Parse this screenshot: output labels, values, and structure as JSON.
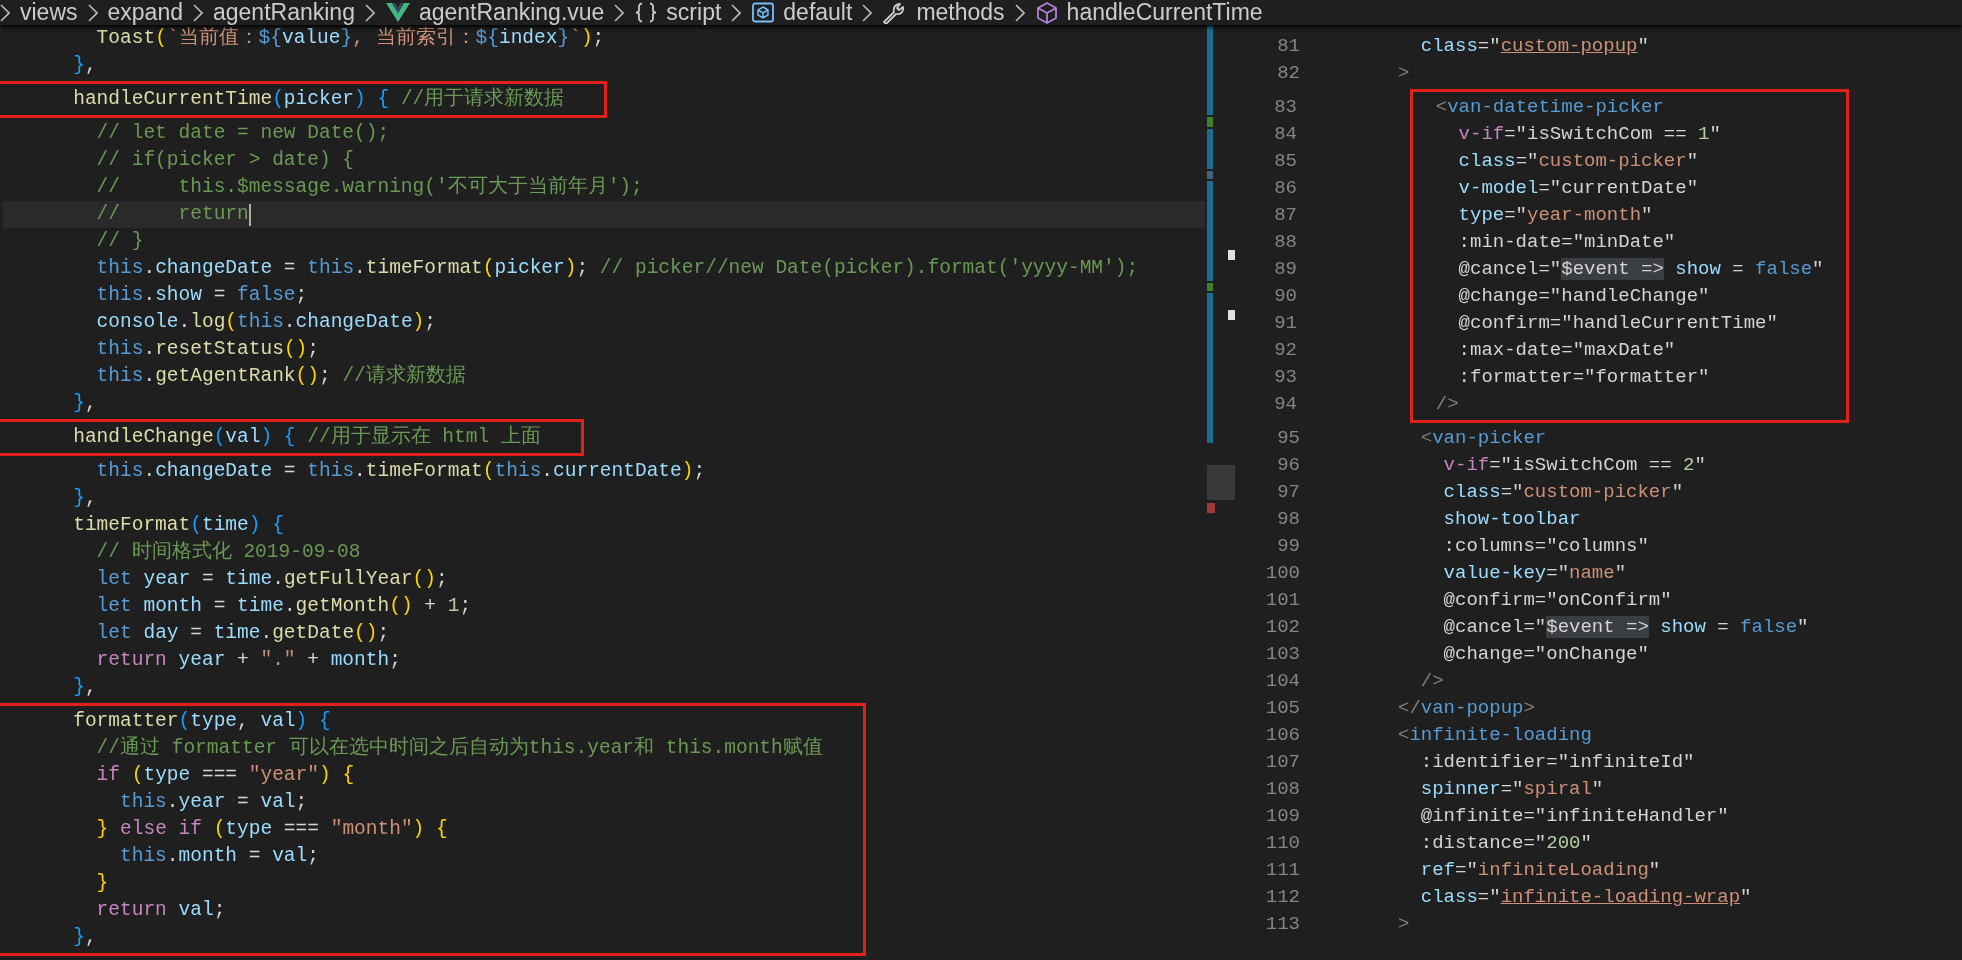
{
  "breadcrumb": [
    {
      "label": "views",
      "kind": "folder"
    },
    {
      "label": "expand",
      "kind": "folder"
    },
    {
      "label": "agentRanking",
      "kind": "folder"
    },
    {
      "label": "agentRanking.vue",
      "kind": "vue"
    },
    {
      "label": "script",
      "kind": "braces"
    },
    {
      "label": "default",
      "kind": "module"
    },
    {
      "label": "methods",
      "kind": "wrench"
    },
    {
      "label": "handleCurrentTime",
      "kind": "cube"
    }
  ],
  "left_editor": {
    "blocks": [
      {
        "boxed": false,
        "lines": [
          {
            "current": false,
            "tokens": [
              {
                "kind": "function",
                "text": "        Toast"
              },
              {
                "kind": "bracket1",
                "text": "("
              },
              {
                "kind": "string",
                "text": "`当前值："
              },
              {
                "kind": "keyword",
                "text": "${"
              },
              {
                "kind": "variable",
                "text": "value"
              },
              {
                "kind": "keyword",
                "text": "}"
              },
              {
                "kind": "string",
                "text": ", 当前索引："
              },
              {
                "kind": "keyword",
                "text": "${"
              },
              {
                "kind": "variable",
                "text": "index"
              },
              {
                "kind": "keyword",
                "text": "}"
              },
              {
                "kind": "string",
                "text": "`"
              },
              {
                "kind": "bracket1",
                "text": ")"
              },
              {
                "kind": "plain",
                "text": ";"
              }
            ]
          },
          {
            "current": false,
            "tokens": [
              {
                "kind": "bracket3",
                "text": "      }"
              },
              {
                "kind": "plain",
                "text": ","
              }
            ]
          }
        ]
      },
      {
        "boxed": true,
        "lines": [
          {
            "current": false,
            "tokens": [
              {
                "kind": "function",
                "text": "      handleCurrentTime"
              },
              {
                "kind": "bracket3",
                "text": "("
              },
              {
                "kind": "variable",
                "text": "picker"
              },
              {
                "kind": "bracket3",
                "text": ") {"
              },
              {
                "kind": "comment",
                "text": " //用于请求新数据"
              }
            ]
          }
        ]
      },
      {
        "boxed": false,
        "lines": [
          {
            "current": false,
            "tokens": [
              {
                "kind": "comment",
                "text": "        // let date = new Date();"
              }
            ]
          },
          {
            "current": false,
            "tokens": [
              {
                "kind": "comment",
                "text": "        // if(picker > date) {"
              }
            ]
          },
          {
            "current": false,
            "tokens": [
              {
                "kind": "comment",
                "text": "        //     this.$message.warning('不可大于当前年月');"
              }
            ]
          },
          {
            "current": true,
            "tokens": [
              {
                "kind": "comment",
                "text": "        //     return"
              }
            ]
          },
          {
            "current": false,
            "tokens": [
              {
                "kind": "comment",
                "text": "        // }"
              }
            ]
          },
          {
            "current": false,
            "tokens": [
              {
                "kind": "keyword",
                "text": "        this"
              },
              {
                "kind": "plain",
                "text": "."
              },
              {
                "kind": "variable",
                "text": "changeDate"
              },
              {
                "kind": "plain",
                "text": " = "
              },
              {
                "kind": "keyword",
                "text": "this"
              },
              {
                "kind": "plain",
                "text": "."
              },
              {
                "kind": "function",
                "text": "timeFormat"
              },
              {
                "kind": "bracket1",
                "text": "("
              },
              {
                "kind": "variable",
                "text": "picker"
              },
              {
                "kind": "bracket1",
                "text": ")"
              },
              {
                "kind": "plain",
                "text": ";"
              },
              {
                "kind": "comment",
                "text": " // picker//new Date(picker).format('yyyy-MM');"
              }
            ]
          },
          {
            "current": false,
            "tokens": [
              {
                "kind": "keyword",
                "text": "        this"
              },
              {
                "kind": "plain",
                "text": "."
              },
              {
                "kind": "variable",
                "text": "show"
              },
              {
                "kind": "plain",
                "text": " = "
              },
              {
                "kind": "keyword",
                "text": "false"
              },
              {
                "kind": "plain",
                "text": ";"
              }
            ]
          },
          {
            "current": false,
            "tokens": [
              {
                "kind": "variable",
                "text": "        console"
              },
              {
                "kind": "plain",
                "text": "."
              },
              {
                "kind": "function",
                "text": "log"
              },
              {
                "kind": "bracket1",
                "text": "("
              },
              {
                "kind": "keyword",
                "text": "this"
              },
              {
                "kind": "plain",
                "text": "."
              },
              {
                "kind": "variable",
                "text": "changeDate"
              },
              {
                "kind": "bracket1",
                "text": ")"
              },
              {
                "kind": "plain",
                "text": ";"
              }
            ]
          },
          {
            "current": false,
            "tokens": [
              {
                "kind": "keyword",
                "text": "        this"
              },
              {
                "kind": "plain",
                "text": "."
              },
              {
                "kind": "function",
                "text": "resetStatus"
              },
              {
                "kind": "bracket1",
                "text": "()"
              },
              {
                "kind": "plain",
                "text": ";"
              }
            ]
          },
          {
            "current": false,
            "tokens": [
              {
                "kind": "keyword",
                "text": "        this"
              },
              {
                "kind": "plain",
                "text": "."
              },
              {
                "kind": "function",
                "text": "getAgentRank"
              },
              {
                "kind": "bracket1",
                "text": "()"
              },
              {
                "kind": "plain",
                "text": ";"
              },
              {
                "kind": "comment",
                "text": " //请求新数据"
              }
            ]
          },
          {
            "current": false,
            "tokens": [
              {
                "kind": "bracket3",
                "text": "      }"
              },
              {
                "kind": "plain",
                "text": ","
              }
            ]
          }
        ]
      },
      {
        "boxed": true,
        "lines": [
          {
            "current": false,
            "tokens": [
              {
                "kind": "function",
                "text": "      handleChange"
              },
              {
                "kind": "bracket3",
                "text": "("
              },
              {
                "kind": "variable",
                "text": "val"
              },
              {
                "kind": "bracket3",
                "text": ") {"
              },
              {
                "kind": "comment",
                "text": " //用于显示在 html 上面"
              }
            ]
          }
        ]
      },
      {
        "boxed": false,
        "lines": [
          {
            "current": false,
            "tokens": [
              {
                "kind": "keyword",
                "text": "        this"
              },
              {
                "kind": "plain",
                "text": "."
              },
              {
                "kind": "variable",
                "text": "changeDate"
              },
              {
                "kind": "plain",
                "text": " = "
              },
              {
                "kind": "keyword",
                "text": "this"
              },
              {
                "kind": "plain",
                "text": "."
              },
              {
                "kind": "function",
                "text": "timeFormat"
              },
              {
                "kind": "bracket1",
                "text": "("
              },
              {
                "kind": "keyword",
                "text": "this"
              },
              {
                "kind": "plain",
                "text": "."
              },
              {
                "kind": "variable",
                "text": "currentDate"
              },
              {
                "kind": "bracket1",
                "text": ")"
              },
              {
                "kind": "plain",
                "text": ";"
              }
            ]
          },
          {
            "current": false,
            "tokens": [
              {
                "kind": "bracket3",
                "text": "      }"
              },
              {
                "kind": "plain",
                "text": ","
              }
            ]
          },
          {
            "current": false,
            "tokens": [
              {
                "kind": "function",
                "text": "      timeFormat"
              },
              {
                "kind": "bracket3",
                "text": "("
              },
              {
                "kind": "variable",
                "text": "time"
              },
              {
                "kind": "bracket3",
                "text": ") {"
              }
            ]
          },
          {
            "current": false,
            "tokens": [
              {
                "kind": "comment",
                "text": "        // 时间格式化 2019-09-08"
              }
            ]
          },
          {
            "current": false,
            "tokens": [
              {
                "kind": "keyword",
                "text": "        let"
              },
              {
                "kind": "variable",
                "text": " year"
              },
              {
                "kind": "plain",
                "text": " = "
              },
              {
                "kind": "variable",
                "text": "time"
              },
              {
                "kind": "plain",
                "text": "."
              },
              {
                "kind": "function",
                "text": "getFullYear"
              },
              {
                "kind": "bracket1",
                "text": "()"
              },
              {
                "kind": "plain",
                "text": ";"
              }
            ]
          },
          {
            "current": false,
            "tokens": [
              {
                "kind": "keyword",
                "text": "        let"
              },
              {
                "kind": "variable",
                "text": " month"
              },
              {
                "kind": "plain",
                "text": " = "
              },
              {
                "kind": "variable",
                "text": "time"
              },
              {
                "kind": "plain",
                "text": "."
              },
              {
                "kind": "function",
                "text": "getMonth"
              },
              {
                "kind": "bracket1",
                "text": "()"
              },
              {
                "kind": "plain",
                "text": " + "
              },
              {
                "kind": "number",
                "text": "1"
              },
              {
                "kind": "plain",
                "text": ";"
              }
            ]
          },
          {
            "current": false,
            "tokens": [
              {
                "kind": "keyword",
                "text": "        let"
              },
              {
                "kind": "variable",
                "text": " day"
              },
              {
                "kind": "plain",
                "text": " = "
              },
              {
                "kind": "variable",
                "text": "time"
              },
              {
                "kind": "plain",
                "text": "."
              },
              {
                "kind": "function",
                "text": "getDate"
              },
              {
                "kind": "bracket1",
                "text": "()"
              },
              {
                "kind": "plain",
                "text": ";"
              }
            ]
          },
          {
            "current": false,
            "tokens": [
              {
                "kind": "control",
                "text": "        return"
              },
              {
                "kind": "variable",
                "text": " year"
              },
              {
                "kind": "plain",
                "text": " + "
              },
              {
                "kind": "string",
                "text": "\".\""
              },
              {
                "kind": "plain",
                "text": " + "
              },
              {
                "kind": "variable",
                "text": "month"
              },
              {
                "kind": "plain",
                "text": ";"
              }
            ]
          },
          {
            "current": false,
            "tokens": [
              {
                "kind": "bracket3",
                "text": "      }"
              },
              {
                "kind": "plain",
                "text": ","
              }
            ]
          }
        ]
      },
      {
        "boxed": true,
        "lines": [
          {
            "current": false,
            "tokens": [
              {
                "kind": "function",
                "text": "      formatter"
              },
              {
                "kind": "bracket3",
                "text": "("
              },
              {
                "kind": "variable",
                "text": "type"
              },
              {
                "kind": "plain",
                "text": ", "
              },
              {
                "kind": "variable",
                "text": "val"
              },
              {
                "kind": "bracket3",
                "text": ") {"
              }
            ]
          },
          {
            "current": false,
            "tokens": [
              {
                "kind": "comment",
                "text": "        //通过 formatter 可以在选中时间之后自动为this.year和 this.month赋值"
              }
            ]
          },
          {
            "current": false,
            "tokens": [
              {
                "kind": "control",
                "text": "        if"
              },
              {
                "kind": "bracket1",
                "text": " ("
              },
              {
                "kind": "variable",
                "text": "type"
              },
              {
                "kind": "plain",
                "text": " === "
              },
              {
                "kind": "string",
                "text": "\"year\""
              },
              {
                "kind": "bracket1",
                "text": ") {"
              }
            ]
          },
          {
            "current": false,
            "tokens": [
              {
                "kind": "keyword",
                "text": "          this"
              },
              {
                "kind": "plain",
                "text": "."
              },
              {
                "kind": "variable",
                "text": "year"
              },
              {
                "kind": "plain",
                "text": " = "
              },
              {
                "kind": "variable",
                "text": "val"
              },
              {
                "kind": "plain",
                "text": ";"
              }
            ]
          },
          {
            "current": false,
            "tokens": [
              {
                "kind": "bracket1",
                "text": "        }"
              },
              {
                "kind": "control",
                "text": " else if"
              },
              {
                "kind": "bracket1",
                "text": " ("
              },
              {
                "kind": "variable",
                "text": "type"
              },
              {
                "kind": "plain",
                "text": " === "
              },
              {
                "kind": "string",
                "text": "\"month\""
              },
              {
                "kind": "bracket1",
                "text": ") {"
              }
            ]
          },
          {
            "current": false,
            "tokens": [
              {
                "kind": "keyword",
                "text": "          this"
              },
              {
                "kind": "plain",
                "text": "."
              },
              {
                "kind": "variable",
                "text": "month"
              },
              {
                "kind": "plain",
                "text": " = "
              },
              {
                "kind": "variable",
                "text": "val"
              },
              {
                "kind": "plain",
                "text": ";"
              }
            ]
          },
          {
            "current": false,
            "tokens": [
              {
                "kind": "bracket1",
                "text": "        }"
              }
            ]
          },
          {
            "current": false,
            "tokens": [
              {
                "kind": "control",
                "text": "        return"
              },
              {
                "kind": "variable",
                "text": " val"
              },
              {
                "kind": "plain",
                "text": ";"
              }
            ]
          },
          {
            "current": false,
            "tokens": [
              {
                "kind": "bracket3",
                "text": "      }"
              },
              {
                "kind": "plain",
                "text": ","
              }
            ]
          }
        ]
      }
    ]
  },
  "right_editor": {
    "blocks": [
      {
        "boxed": false,
        "lines": [
          {
            "number": "81",
            "tokens": [
              {
                "kind": "attribute",
                "text": "  class"
              },
              {
                "kind": "plain",
                "text": "=\""
              },
              {
                "kind": "link",
                "text": "custom-popup"
              },
              {
                "kind": "plain",
                "text": "\""
              }
            ]
          },
          {
            "number": "82",
            "tokens": [
              {
                "kind": "punctuation",
                "text": ">"
              }
            ]
          }
        ]
      },
      {
        "boxed": true,
        "lines": [
          {
            "number": "83",
            "tokens": [
              {
                "kind": "punctuation",
                "text": "  <"
              },
              {
                "kind": "tag",
                "text": "van-datetime-picker"
              }
            ]
          },
          {
            "number": "84",
            "tokens": [
              {
                "kind": "directive",
                "text": "    v-if"
              },
              {
                "kind": "plain",
                "text": "=\"isSwitchCom == "
              },
              {
                "kind": "number",
                "text": "1"
              },
              {
                "kind": "plain",
                "text": "\""
              }
            ]
          },
          {
            "number": "85",
            "tokens": [
              {
                "kind": "attribute",
                "text": "    class"
              },
              {
                "kind": "plain",
                "text": "=\""
              },
              {
                "kind": "string",
                "text": "custom-picker"
              },
              {
                "kind": "plain",
                "text": "\""
              }
            ]
          },
          {
            "number": "86",
            "tokens": [
              {
                "kind": "attribute",
                "text": "    v-model"
              },
              {
                "kind": "plain",
                "text": "=\"currentDate\""
              }
            ]
          },
          {
            "number": "87",
            "tokens": [
              {
                "kind": "attribute",
                "text": "    type"
              },
              {
                "kind": "plain",
                "text": "=\""
              },
              {
                "kind": "string",
                "text": "year-month"
              },
              {
                "kind": "plain",
                "text": "\""
              }
            ]
          },
          {
            "number": "88",
            "tokens": [
              {
                "kind": "plain",
                "text": "    :min-date=\"minDate\""
              }
            ]
          },
          {
            "number": "89",
            "tokens": [
              {
                "kind": "plain",
                "text": "    @cancel=\""
              },
              {
                "kind": "selection",
                "text": "$event =>"
              },
              {
                "kind": "variable",
                "text": " show"
              },
              {
                "kind": "plain",
                "text": " = "
              },
              {
                "kind": "keyword",
                "text": "false"
              },
              {
                "kind": "plain",
                "text": "\""
              }
            ]
          },
          {
            "number": "90",
            "tokens": [
              {
                "kind": "plain",
                "text": "    @change=\"handleChange\""
              }
            ]
          },
          {
            "number": "91",
            "tokens": [
              {
                "kind": "plain",
                "text": "    @confirm=\"handleCurrentTime\""
              }
            ]
          },
          {
            "number": "92",
            "tokens": [
              {
                "kind": "plain",
                "text": "    :max-date=\"maxDate\""
              }
            ]
          },
          {
            "number": "93",
            "tokens": [
              {
                "kind": "plain",
                "text": "    :formatter=\"formatter\""
              }
            ]
          },
          {
            "number": "94",
            "tokens": [
              {
                "kind": "punctuation",
                "text": "  />"
              }
            ]
          }
        ]
      },
      {
        "boxed": false,
        "lines": [
          {
            "number": "95",
            "tokens": [
              {
                "kind": "punctuation",
                "text": "  <"
              },
              {
                "kind": "tag",
                "text": "van-picker"
              }
            ]
          },
          {
            "number": "96",
            "tokens": [
              {
                "kind": "directive",
                "text": "    v-if"
              },
              {
                "kind": "plain",
                "text": "=\"isSwitchCom == "
              },
              {
                "kind": "number",
                "text": "2"
              },
              {
                "kind": "plain",
                "text": "\""
              }
            ]
          },
          {
            "number": "97",
            "tokens": [
              {
                "kind": "attribute",
                "text": "    class"
              },
              {
                "kind": "plain",
                "text": "=\""
              },
              {
                "kind": "string",
                "text": "custom-picker"
              },
              {
                "kind": "plain",
                "text": "\""
              }
            ]
          },
          {
            "number": "98",
            "tokens": [
              {
                "kind": "attribute",
                "text": "    show-toolbar"
              }
            ]
          },
          {
            "number": "99",
            "tokens": [
              {
                "kind": "plain",
                "text": "    :columns=\"columns\""
              }
            ]
          },
          {
            "number": "100",
            "tokens": [
              {
                "kind": "attribute",
                "text": "    value-key"
              },
              {
                "kind": "plain",
                "text": "=\""
              },
              {
                "kind": "string",
                "text": "name"
              },
              {
                "kind": "plain",
                "text": "\""
              }
            ]
          },
          {
            "number": "101",
            "tokens": [
              {
                "kind": "plain",
                "text": "    @confirm=\"onConfirm\""
              }
            ]
          },
          {
            "number": "102",
            "tokens": [
              {
                "kind": "plain",
                "text": "    @cancel=\""
              },
              {
                "kind": "selection",
                "text": "$event =>"
              },
              {
                "kind": "variable",
                "text": " show"
              },
              {
                "kind": "plain",
                "text": " = "
              },
              {
                "kind": "keyword",
                "text": "false"
              },
              {
                "kind": "plain",
                "text": "\""
              }
            ]
          },
          {
            "number": "103",
            "tokens": [
              {
                "kind": "plain",
                "text": "    @change=\"onChange\""
              }
            ]
          },
          {
            "number": "104",
            "tokens": [
              {
                "kind": "punctuation",
                "text": "  />"
              }
            ]
          },
          {
            "number": "105",
            "tokens": [
              {
                "kind": "punctuation",
                "text": "</"
              },
              {
                "kind": "tag",
                "text": "van-popup"
              },
              {
                "kind": "punctuation",
                "text": ">"
              }
            ]
          },
          {
            "number": "106",
            "tokens": [
              {
                "kind": "punctuation",
                "text": "<"
              },
              {
                "kind": "tag",
                "text": "infinite-loading"
              }
            ]
          },
          {
            "number": "107",
            "tokens": [
              {
                "kind": "plain",
                "text": "  :identifier=\"infiniteId\""
              }
            ]
          },
          {
            "number": "108",
            "tokens": [
              {
                "kind": "attribute",
                "text": "  spinner"
              },
              {
                "kind": "plain",
                "text": "=\""
              },
              {
                "kind": "string",
                "text": "spiral"
              },
              {
                "kind": "plain",
                "text": "\""
              }
            ]
          },
          {
            "number": "109",
            "tokens": [
              {
                "kind": "plain",
                "text": "  @infinite=\"infiniteHandler\""
              }
            ]
          },
          {
            "number": "110",
            "tokens": [
              {
                "kind": "plain",
                "text": "  :distance=\""
              },
              {
                "kind": "number",
                "text": "200"
              },
              {
                "kind": "plain",
                "text": "\""
              }
            ]
          },
          {
            "number": "111",
            "tokens": [
              {
                "kind": "attribute",
                "text": "  ref"
              },
              {
                "kind": "plain",
                "text": "=\""
              },
              {
                "kind": "string",
                "text": "infiniteLoading"
              },
              {
                "kind": "plain",
                "text": "\""
              }
            ]
          },
          {
            "number": "112",
            "tokens": [
              {
                "kind": "attribute",
                "text": "  class"
              },
              {
                "kind": "plain",
                "text": "=\""
              },
              {
                "kind": "link",
                "text": "infinite-loading-wrap"
              },
              {
                "kind": "plain",
                "text": "\""
              }
            ]
          },
          {
            "number": "113",
            "tokens": [
              {
                "kind": "punctuation",
                "text": ">"
              }
            ]
          }
        ]
      }
    ]
  }
}
